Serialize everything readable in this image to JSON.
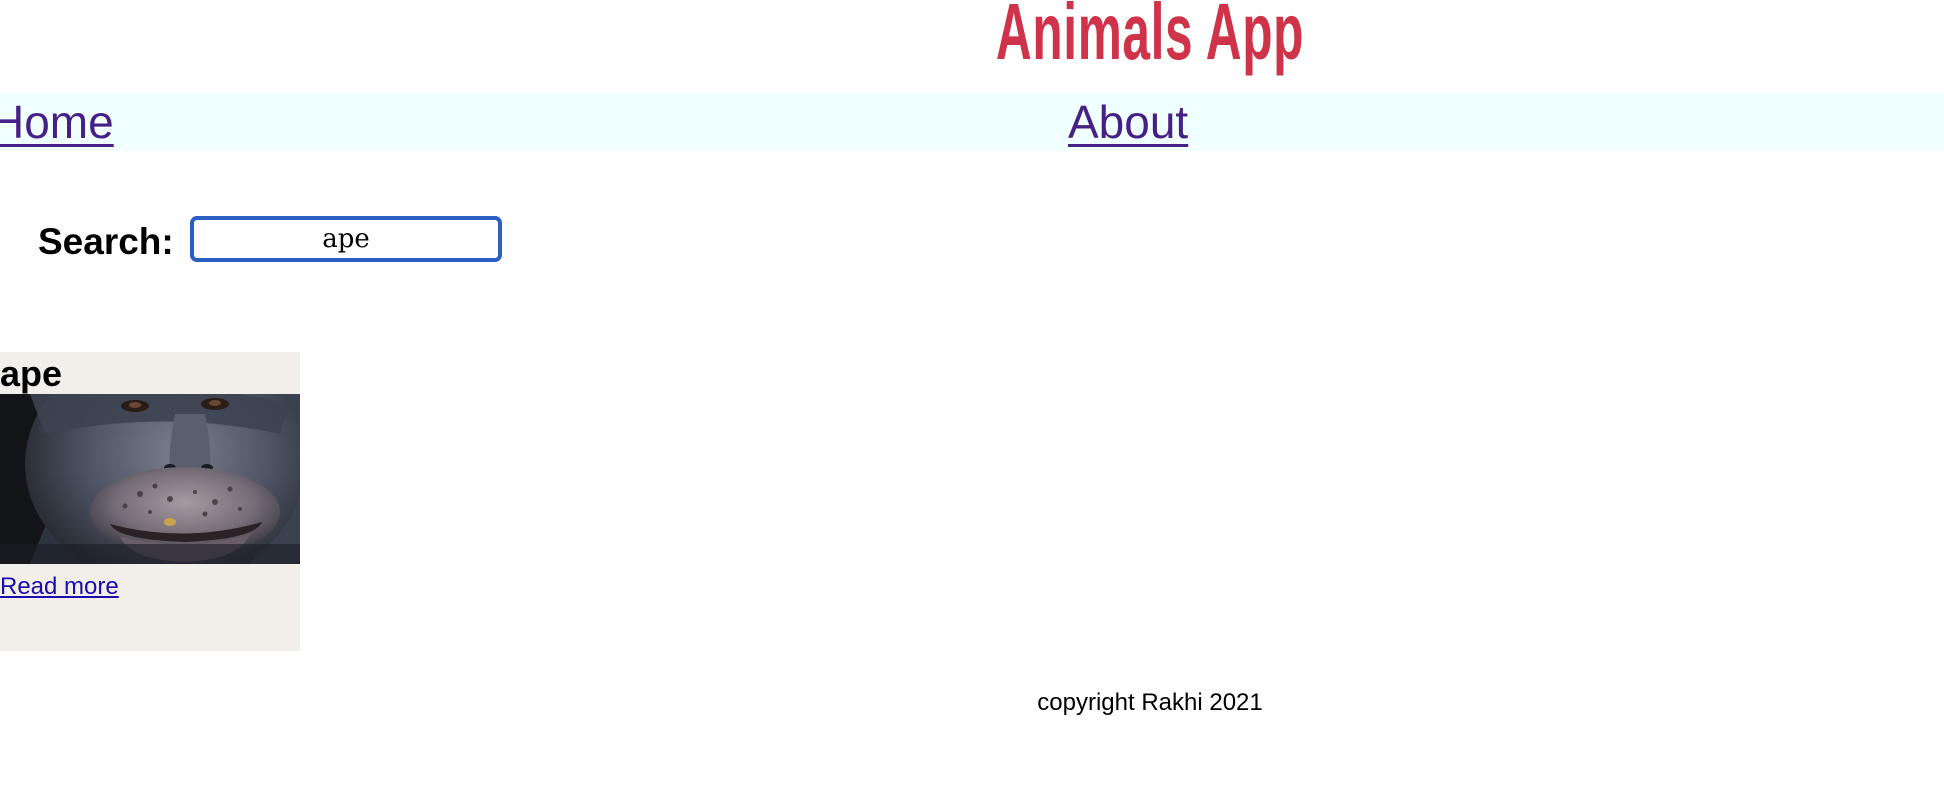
{
  "header": {
    "title": "Animals App"
  },
  "nav": {
    "home_label": "Home",
    "about_label": "About"
  },
  "search": {
    "label": "Search:",
    "value": "ape"
  },
  "results": [
    {
      "title": "ape",
      "image": "chimpanzee face photo",
      "link_label": "Read more"
    }
  ],
  "footer": {
    "text": "copyright Rakhi 2021"
  },
  "colors": {
    "title": "#cf3349",
    "nav_background": "#f0ffff",
    "nav_link": "#461f87",
    "search_border": "#2c5fc4",
    "card_background": "#f2efeb",
    "link": "#1a0dab"
  }
}
